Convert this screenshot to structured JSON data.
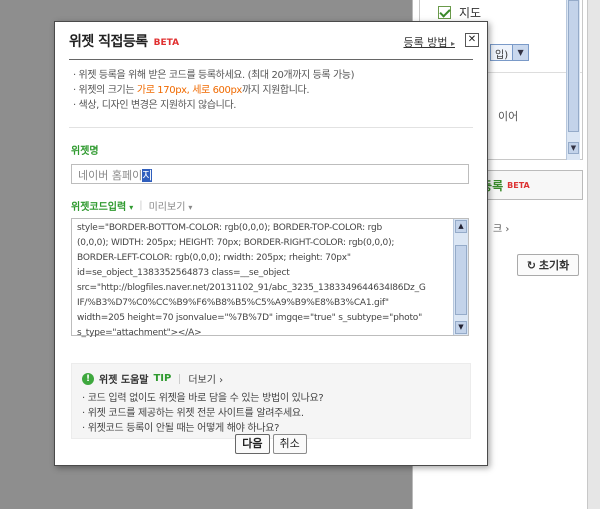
{
  "background": {
    "map_checkbox_label": "지도",
    "select_value": "입)",
    "layer_text": "이어",
    "register_button": {
      "label": "젯등록",
      "beta": "BETA"
    },
    "link_text": "크 ›",
    "reset_button": "초기화"
  },
  "modal": {
    "title": "위젯 직접등록",
    "beta": "BETA",
    "help_link": "등록 방법",
    "close_symbol": "✕",
    "notices": [
      {
        "pre": "· 위젯 등록을 위해 받은 코드를 등록하세요. (최대 20개까지 등록 가능)",
        "hl": "",
        "post": ""
      },
      {
        "pre": "· 위젯의 크기는 ",
        "hl": "가로 170px, 세로 600px",
        "post": "까지 지원합니다."
      },
      {
        "pre": "· 색상, 디자인 변경은 지원하지 않습니다.",
        "hl": "",
        "post": ""
      }
    ],
    "name_label": "위젯명",
    "name_value_plain": "네이버 홈페이",
    "name_value_selected": "지",
    "tab_code": "위젯코드입력",
    "tab_preview": "미리보기",
    "code_value": "style=\"BORDER-BOTTOM-COLOR: rgb(0,0,0); BORDER-TOP-COLOR: rgb\n(0,0,0); WIDTH: 205px; HEIGHT: 70px; BORDER-RIGHT-COLOR: rgb(0,0,0);\nBORDER-LEFT-COLOR: rgb(0,0,0); rwidth: 205px; rheight: 70px\"\nid=se_object_1383352564873 class=__se_object\nsrc=\"http://blogfiles.naver.net/20131102_91/abc_3235_1383349644634I86Dz_G\nIF/%B3%D7%C0%CC%B9%F6%B8%B5%C5%A9%B9%E8%B3%CA1.gif\"\nwidth=205 height=70 jsonvalue=\"%7B%7D\" imgqe=\"true\" s_subtype=\"photo\"\ns_type=\"attachment\"></A>",
    "tip": {
      "icon": "!",
      "title": "위젯 도움말",
      "badge": "TIP",
      "more": "더보기 ›",
      "items": [
        "· 코드 입력 없이도 위젯을 바로 담을 수 있는 방법이 있나요?",
        "· 위젯 코드를 제공하는 위젯 전문 사이트를 알려주세요.",
        "· 위젯코드 등록이 안될 때는 어떻게 해야 하나요?"
      ]
    },
    "next_button": "다음",
    "cancel_button": "취소"
  },
  "colors": {
    "accent_green": "#2f9a2f",
    "beta_red": "#e03030",
    "highlight_orange": "#f06a00",
    "overlay_gray": "#8e8e8e"
  }
}
